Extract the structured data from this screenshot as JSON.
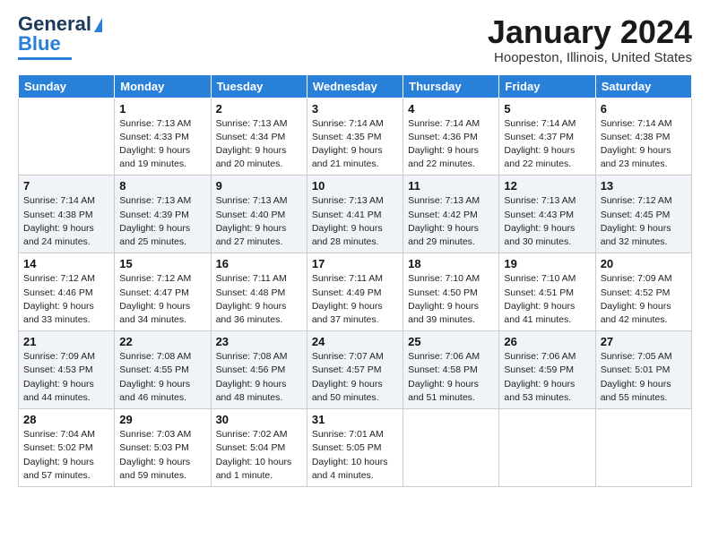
{
  "logo": {
    "line1": "General",
    "line2": "Blue"
  },
  "header": {
    "title": "January 2024",
    "subtitle": "Hoopeston, Illinois, United States"
  },
  "days_of_week": [
    "Sunday",
    "Monday",
    "Tuesday",
    "Wednesday",
    "Thursday",
    "Friday",
    "Saturday"
  ],
  "weeks": [
    [
      {
        "day": "",
        "sunrise": "",
        "sunset": "",
        "daylight": ""
      },
      {
        "day": "1",
        "sunrise": "Sunrise: 7:13 AM",
        "sunset": "Sunset: 4:33 PM",
        "daylight": "Daylight: 9 hours and 19 minutes."
      },
      {
        "day": "2",
        "sunrise": "Sunrise: 7:13 AM",
        "sunset": "Sunset: 4:34 PM",
        "daylight": "Daylight: 9 hours and 20 minutes."
      },
      {
        "day": "3",
        "sunrise": "Sunrise: 7:14 AM",
        "sunset": "Sunset: 4:35 PM",
        "daylight": "Daylight: 9 hours and 21 minutes."
      },
      {
        "day": "4",
        "sunrise": "Sunrise: 7:14 AM",
        "sunset": "Sunset: 4:36 PM",
        "daylight": "Daylight: 9 hours and 22 minutes."
      },
      {
        "day": "5",
        "sunrise": "Sunrise: 7:14 AM",
        "sunset": "Sunset: 4:37 PM",
        "daylight": "Daylight: 9 hours and 22 minutes."
      },
      {
        "day": "6",
        "sunrise": "Sunrise: 7:14 AM",
        "sunset": "Sunset: 4:38 PM",
        "daylight": "Daylight: 9 hours and 23 minutes."
      }
    ],
    [
      {
        "day": "7",
        "sunrise": "Sunrise: 7:14 AM",
        "sunset": "Sunset: 4:38 PM",
        "daylight": "Daylight: 9 hours and 24 minutes."
      },
      {
        "day": "8",
        "sunrise": "Sunrise: 7:13 AM",
        "sunset": "Sunset: 4:39 PM",
        "daylight": "Daylight: 9 hours and 25 minutes."
      },
      {
        "day": "9",
        "sunrise": "Sunrise: 7:13 AM",
        "sunset": "Sunset: 4:40 PM",
        "daylight": "Daylight: 9 hours and 27 minutes."
      },
      {
        "day": "10",
        "sunrise": "Sunrise: 7:13 AM",
        "sunset": "Sunset: 4:41 PM",
        "daylight": "Daylight: 9 hours and 28 minutes."
      },
      {
        "day": "11",
        "sunrise": "Sunrise: 7:13 AM",
        "sunset": "Sunset: 4:42 PM",
        "daylight": "Daylight: 9 hours and 29 minutes."
      },
      {
        "day": "12",
        "sunrise": "Sunrise: 7:13 AM",
        "sunset": "Sunset: 4:43 PM",
        "daylight": "Daylight: 9 hours and 30 minutes."
      },
      {
        "day": "13",
        "sunrise": "Sunrise: 7:12 AM",
        "sunset": "Sunset: 4:45 PM",
        "daylight": "Daylight: 9 hours and 32 minutes."
      }
    ],
    [
      {
        "day": "14",
        "sunrise": "Sunrise: 7:12 AM",
        "sunset": "Sunset: 4:46 PM",
        "daylight": "Daylight: 9 hours and 33 minutes."
      },
      {
        "day": "15",
        "sunrise": "Sunrise: 7:12 AM",
        "sunset": "Sunset: 4:47 PM",
        "daylight": "Daylight: 9 hours and 34 minutes."
      },
      {
        "day": "16",
        "sunrise": "Sunrise: 7:11 AM",
        "sunset": "Sunset: 4:48 PM",
        "daylight": "Daylight: 9 hours and 36 minutes."
      },
      {
        "day": "17",
        "sunrise": "Sunrise: 7:11 AM",
        "sunset": "Sunset: 4:49 PM",
        "daylight": "Daylight: 9 hours and 37 minutes."
      },
      {
        "day": "18",
        "sunrise": "Sunrise: 7:10 AM",
        "sunset": "Sunset: 4:50 PM",
        "daylight": "Daylight: 9 hours and 39 minutes."
      },
      {
        "day": "19",
        "sunrise": "Sunrise: 7:10 AM",
        "sunset": "Sunset: 4:51 PM",
        "daylight": "Daylight: 9 hours and 41 minutes."
      },
      {
        "day": "20",
        "sunrise": "Sunrise: 7:09 AM",
        "sunset": "Sunset: 4:52 PM",
        "daylight": "Daylight: 9 hours and 42 minutes."
      }
    ],
    [
      {
        "day": "21",
        "sunrise": "Sunrise: 7:09 AM",
        "sunset": "Sunset: 4:53 PM",
        "daylight": "Daylight: 9 hours and 44 minutes."
      },
      {
        "day": "22",
        "sunrise": "Sunrise: 7:08 AM",
        "sunset": "Sunset: 4:55 PM",
        "daylight": "Daylight: 9 hours and 46 minutes."
      },
      {
        "day": "23",
        "sunrise": "Sunrise: 7:08 AM",
        "sunset": "Sunset: 4:56 PM",
        "daylight": "Daylight: 9 hours and 48 minutes."
      },
      {
        "day": "24",
        "sunrise": "Sunrise: 7:07 AM",
        "sunset": "Sunset: 4:57 PM",
        "daylight": "Daylight: 9 hours and 50 minutes."
      },
      {
        "day": "25",
        "sunrise": "Sunrise: 7:06 AM",
        "sunset": "Sunset: 4:58 PM",
        "daylight": "Daylight: 9 hours and 51 minutes."
      },
      {
        "day": "26",
        "sunrise": "Sunrise: 7:06 AM",
        "sunset": "Sunset: 4:59 PM",
        "daylight": "Daylight: 9 hours and 53 minutes."
      },
      {
        "day": "27",
        "sunrise": "Sunrise: 7:05 AM",
        "sunset": "Sunset: 5:01 PM",
        "daylight": "Daylight: 9 hours and 55 minutes."
      }
    ],
    [
      {
        "day": "28",
        "sunrise": "Sunrise: 7:04 AM",
        "sunset": "Sunset: 5:02 PM",
        "daylight": "Daylight: 9 hours and 57 minutes."
      },
      {
        "day": "29",
        "sunrise": "Sunrise: 7:03 AM",
        "sunset": "Sunset: 5:03 PM",
        "daylight": "Daylight: 9 hours and 59 minutes."
      },
      {
        "day": "30",
        "sunrise": "Sunrise: 7:02 AM",
        "sunset": "Sunset: 5:04 PM",
        "daylight": "Daylight: 10 hours and 1 minute."
      },
      {
        "day": "31",
        "sunrise": "Sunrise: 7:01 AM",
        "sunset": "Sunset: 5:05 PM",
        "daylight": "Daylight: 10 hours and 4 minutes."
      },
      {
        "day": "",
        "sunrise": "",
        "sunset": "",
        "daylight": ""
      },
      {
        "day": "",
        "sunrise": "",
        "sunset": "",
        "daylight": ""
      },
      {
        "day": "",
        "sunrise": "",
        "sunset": "",
        "daylight": ""
      }
    ]
  ]
}
